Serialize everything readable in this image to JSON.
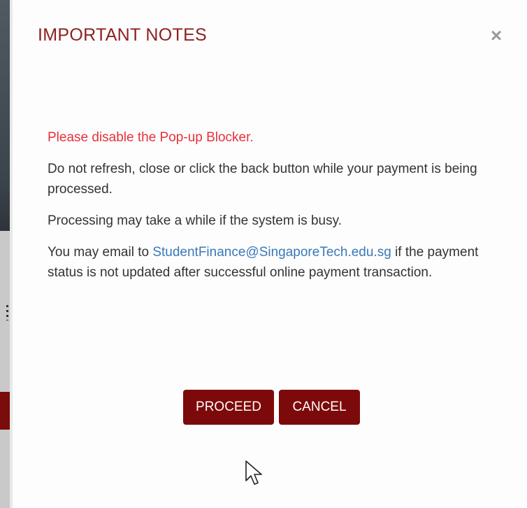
{
  "dialog": {
    "title": "IMPORTANT NOTES",
    "close_icon": "close-icon",
    "close_glyph": "×",
    "notes": {
      "warning": "Please disable the Pop-up Blocker.",
      "refresh": "Do not refresh, close or click the back button while your payment is being processed.",
      "busy": "Processing may take a while if the system is busy.",
      "email_prefix": "You may email to ",
      "email_link": "StudentFinance@SingaporeTech.edu.sg",
      "email_suffix": " if the payment status is not updated after successful online payment transaction."
    },
    "buttons": {
      "proceed": "PROCEED",
      "cancel": "CANCEL"
    }
  },
  "colors": {
    "title": "#8e1f1f",
    "warning": "#e8313a",
    "link": "#3a79b8",
    "button": "#7d0a0a"
  }
}
